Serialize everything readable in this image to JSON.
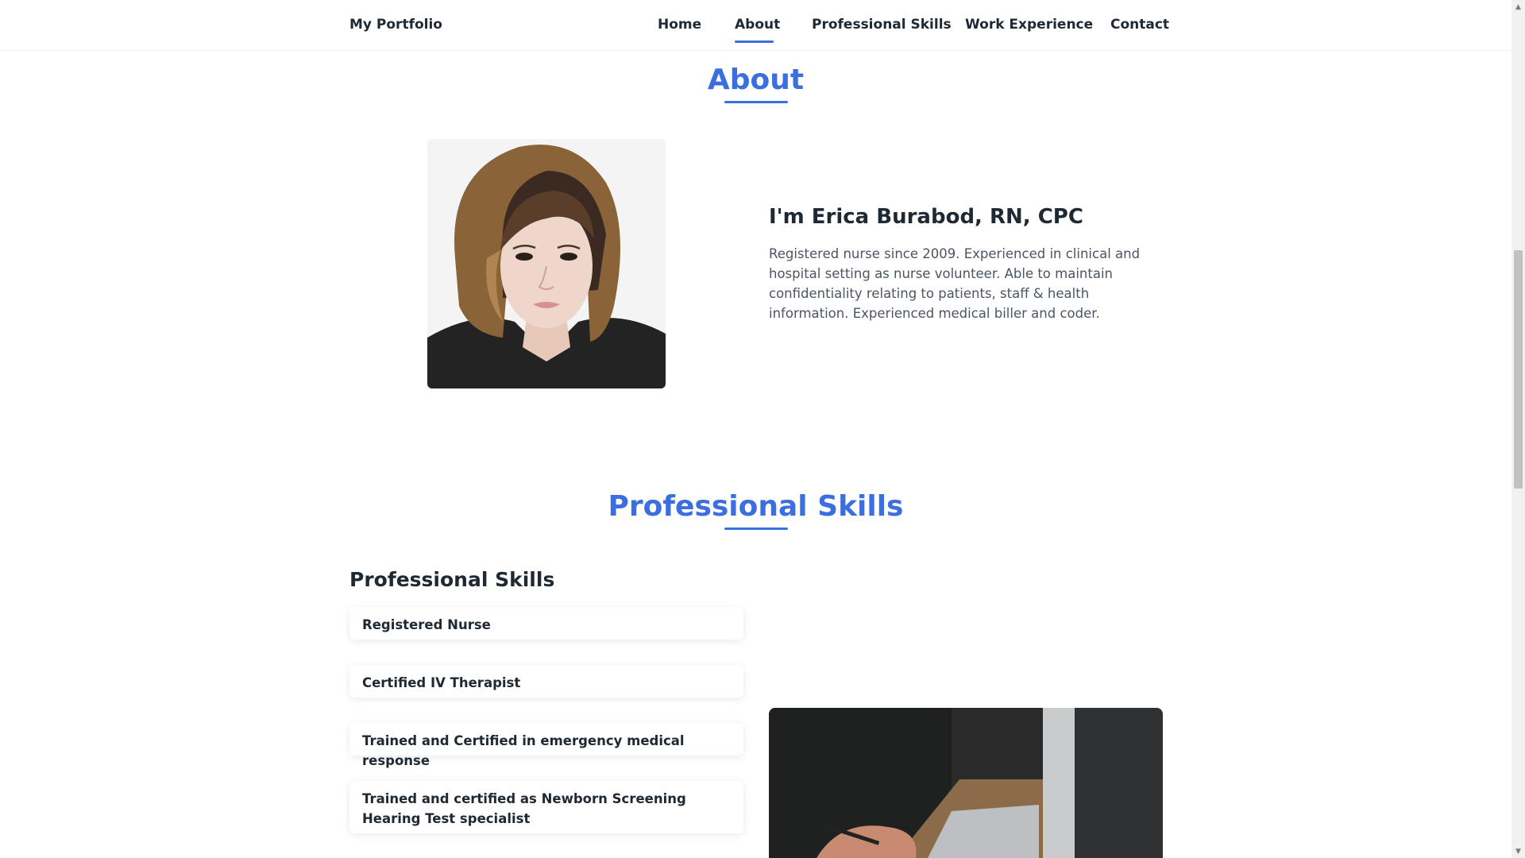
{
  "header": {
    "brand": "My Portfolio",
    "nav": {
      "home": "Home",
      "about": "About",
      "skills": "Professional Skills",
      "work": "Work Experience",
      "contact": "Contact"
    },
    "active_item": "About"
  },
  "about": {
    "section_title": "About",
    "name": "I'm Erica Burabod, RN, CPC",
    "bio": "Registered nurse since 2009. Experienced in clinical and hospital setting as nurse volunteer. Able to maintain confidentiality relating to patients, staff & health information. Experienced medical biller and coder."
  },
  "skills": {
    "section_title": "Professional Skills",
    "subtitle": "Professional Skills",
    "items": [
      "Registered Nurse",
      "Certified IV Therapist",
      "Trained and Certified in emergency medical response",
      "Trained and certified as Newborn Screening Hearing Test specialist"
    ]
  },
  "colors": {
    "accent": "#3b6fe0",
    "text_dark": "#1f2933",
    "text_body": "#4b5563"
  }
}
